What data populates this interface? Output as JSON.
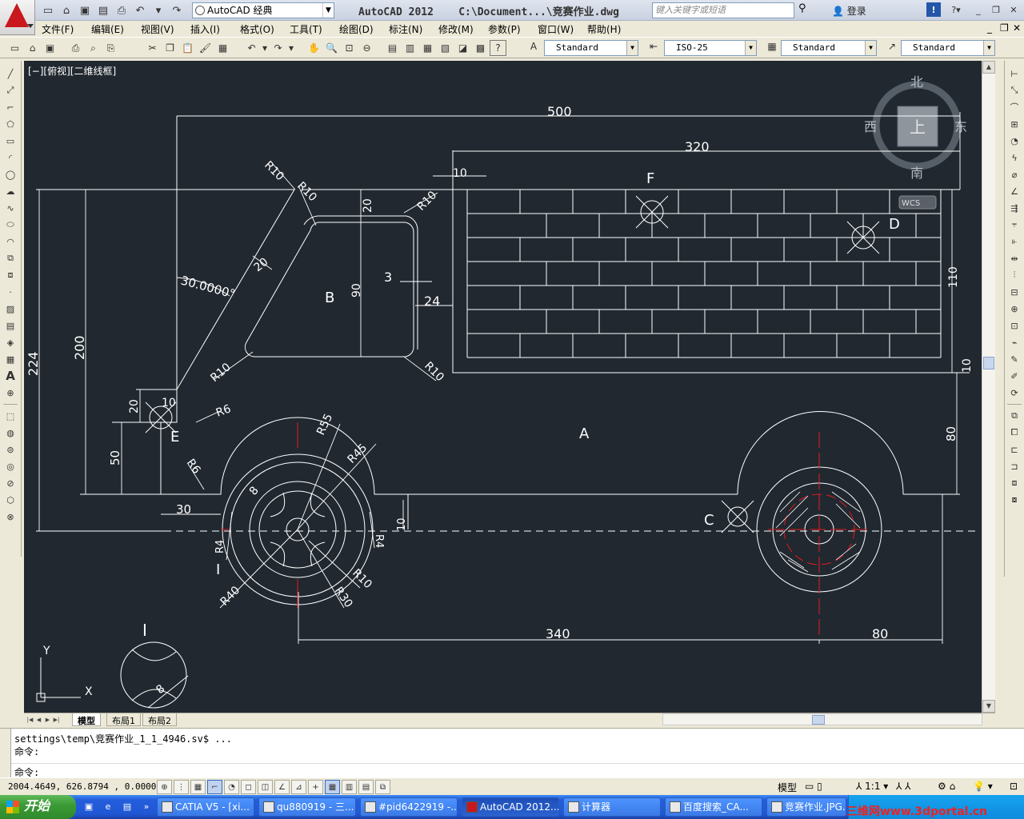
{
  "titlebar": {
    "app_title": "AutoCAD 2012",
    "doc_path": "C:\\Document...\\竞赛作业.dwg",
    "workspace": "AutoCAD 经典",
    "search_placeholder": "键入关键字或短语",
    "login_label": "登录"
  },
  "menu": [
    "文件(F)",
    "编辑(E)",
    "视图(V)",
    "插入(I)",
    "格式(O)",
    "工具(T)",
    "绘图(D)",
    "标注(N)",
    "修改(M)",
    "参数(P)",
    "窗口(W)",
    "帮助(H)"
  ],
  "styles": {
    "text_style": "Standard",
    "dim_style": "ISO-25",
    "table_style": "Standard",
    "mleader_style": "Standard"
  },
  "viewport": {
    "label": "[−][俯视][二维线框]",
    "viewcube": {
      "north": "北",
      "south": "南",
      "east": "东",
      "west": "西",
      "face": "上",
      "wcs": "WCS"
    }
  },
  "drawing": {
    "dims": {
      "overall_length": "500",
      "box_length": "320",
      "gap10_top": "10",
      "box_height": "110",
      "box_bottom_10": "10",
      "cab_height": "224",
      "cab_inner": "200",
      "window_top": "20",
      "window_height": "90",
      "window_side": "3",
      "window_right": "24",
      "angle": "30.0000°",
      "frame": "20",
      "hood_20": "20",
      "hood_10": "10",
      "front_50": "50",
      "front_30": "30",
      "bottom_80": "80",
      "wheelbase": "340",
      "rear_overhang": "80",
      "axle_10": "10",
      "r10a": "R10",
      "r10b": "R10",
      "r10c": "R10",
      "r10d": "R10",
      "r10e": "R10",
      "r6a": "R6",
      "r6b": "R6",
      "r55": "R55",
      "r45": "R45",
      "r40": "R40",
      "r30": "R30",
      "r10w": "R10",
      "r4a": "R4",
      "r4b": "R4",
      "d8": "8",
      "d8b": "8"
    },
    "labels": {
      "a": "A",
      "b": "B",
      "c": "C",
      "d": "D",
      "e": "E",
      "f": "F",
      "i_marker": "I",
      "detail_title": "I"
    },
    "ucs": {
      "x": "X",
      "y": "Y"
    }
  },
  "layout_tabs": [
    "模型",
    "布局1",
    "布局2"
  ],
  "command": {
    "history_line1": "settings\\temp\\竞赛作业_1_1_4946.sv$ ...",
    "history_line2": "命令:",
    "prompt": "命令:"
  },
  "status": {
    "coordinates": "2004.4649, 626.8794 , 0.0000",
    "model_label": "模型",
    "scale": "1:1"
  },
  "taskbar": {
    "start": "开始",
    "tasks": [
      "CATIA V5 - [xi...",
      "qu880919 - 三...",
      "#pid6422919 -...",
      "AutoCAD 2012...",
      "计算器",
      "百度搜索_CA...",
      "竞赛作业.JPG..."
    ],
    "watermark": "三维网www.3dportal.cn"
  },
  "colors": {
    "canvas": "#212830",
    "draw": "#ffffff",
    "center": "#e21b1b",
    "accent": "#316ac5"
  }
}
